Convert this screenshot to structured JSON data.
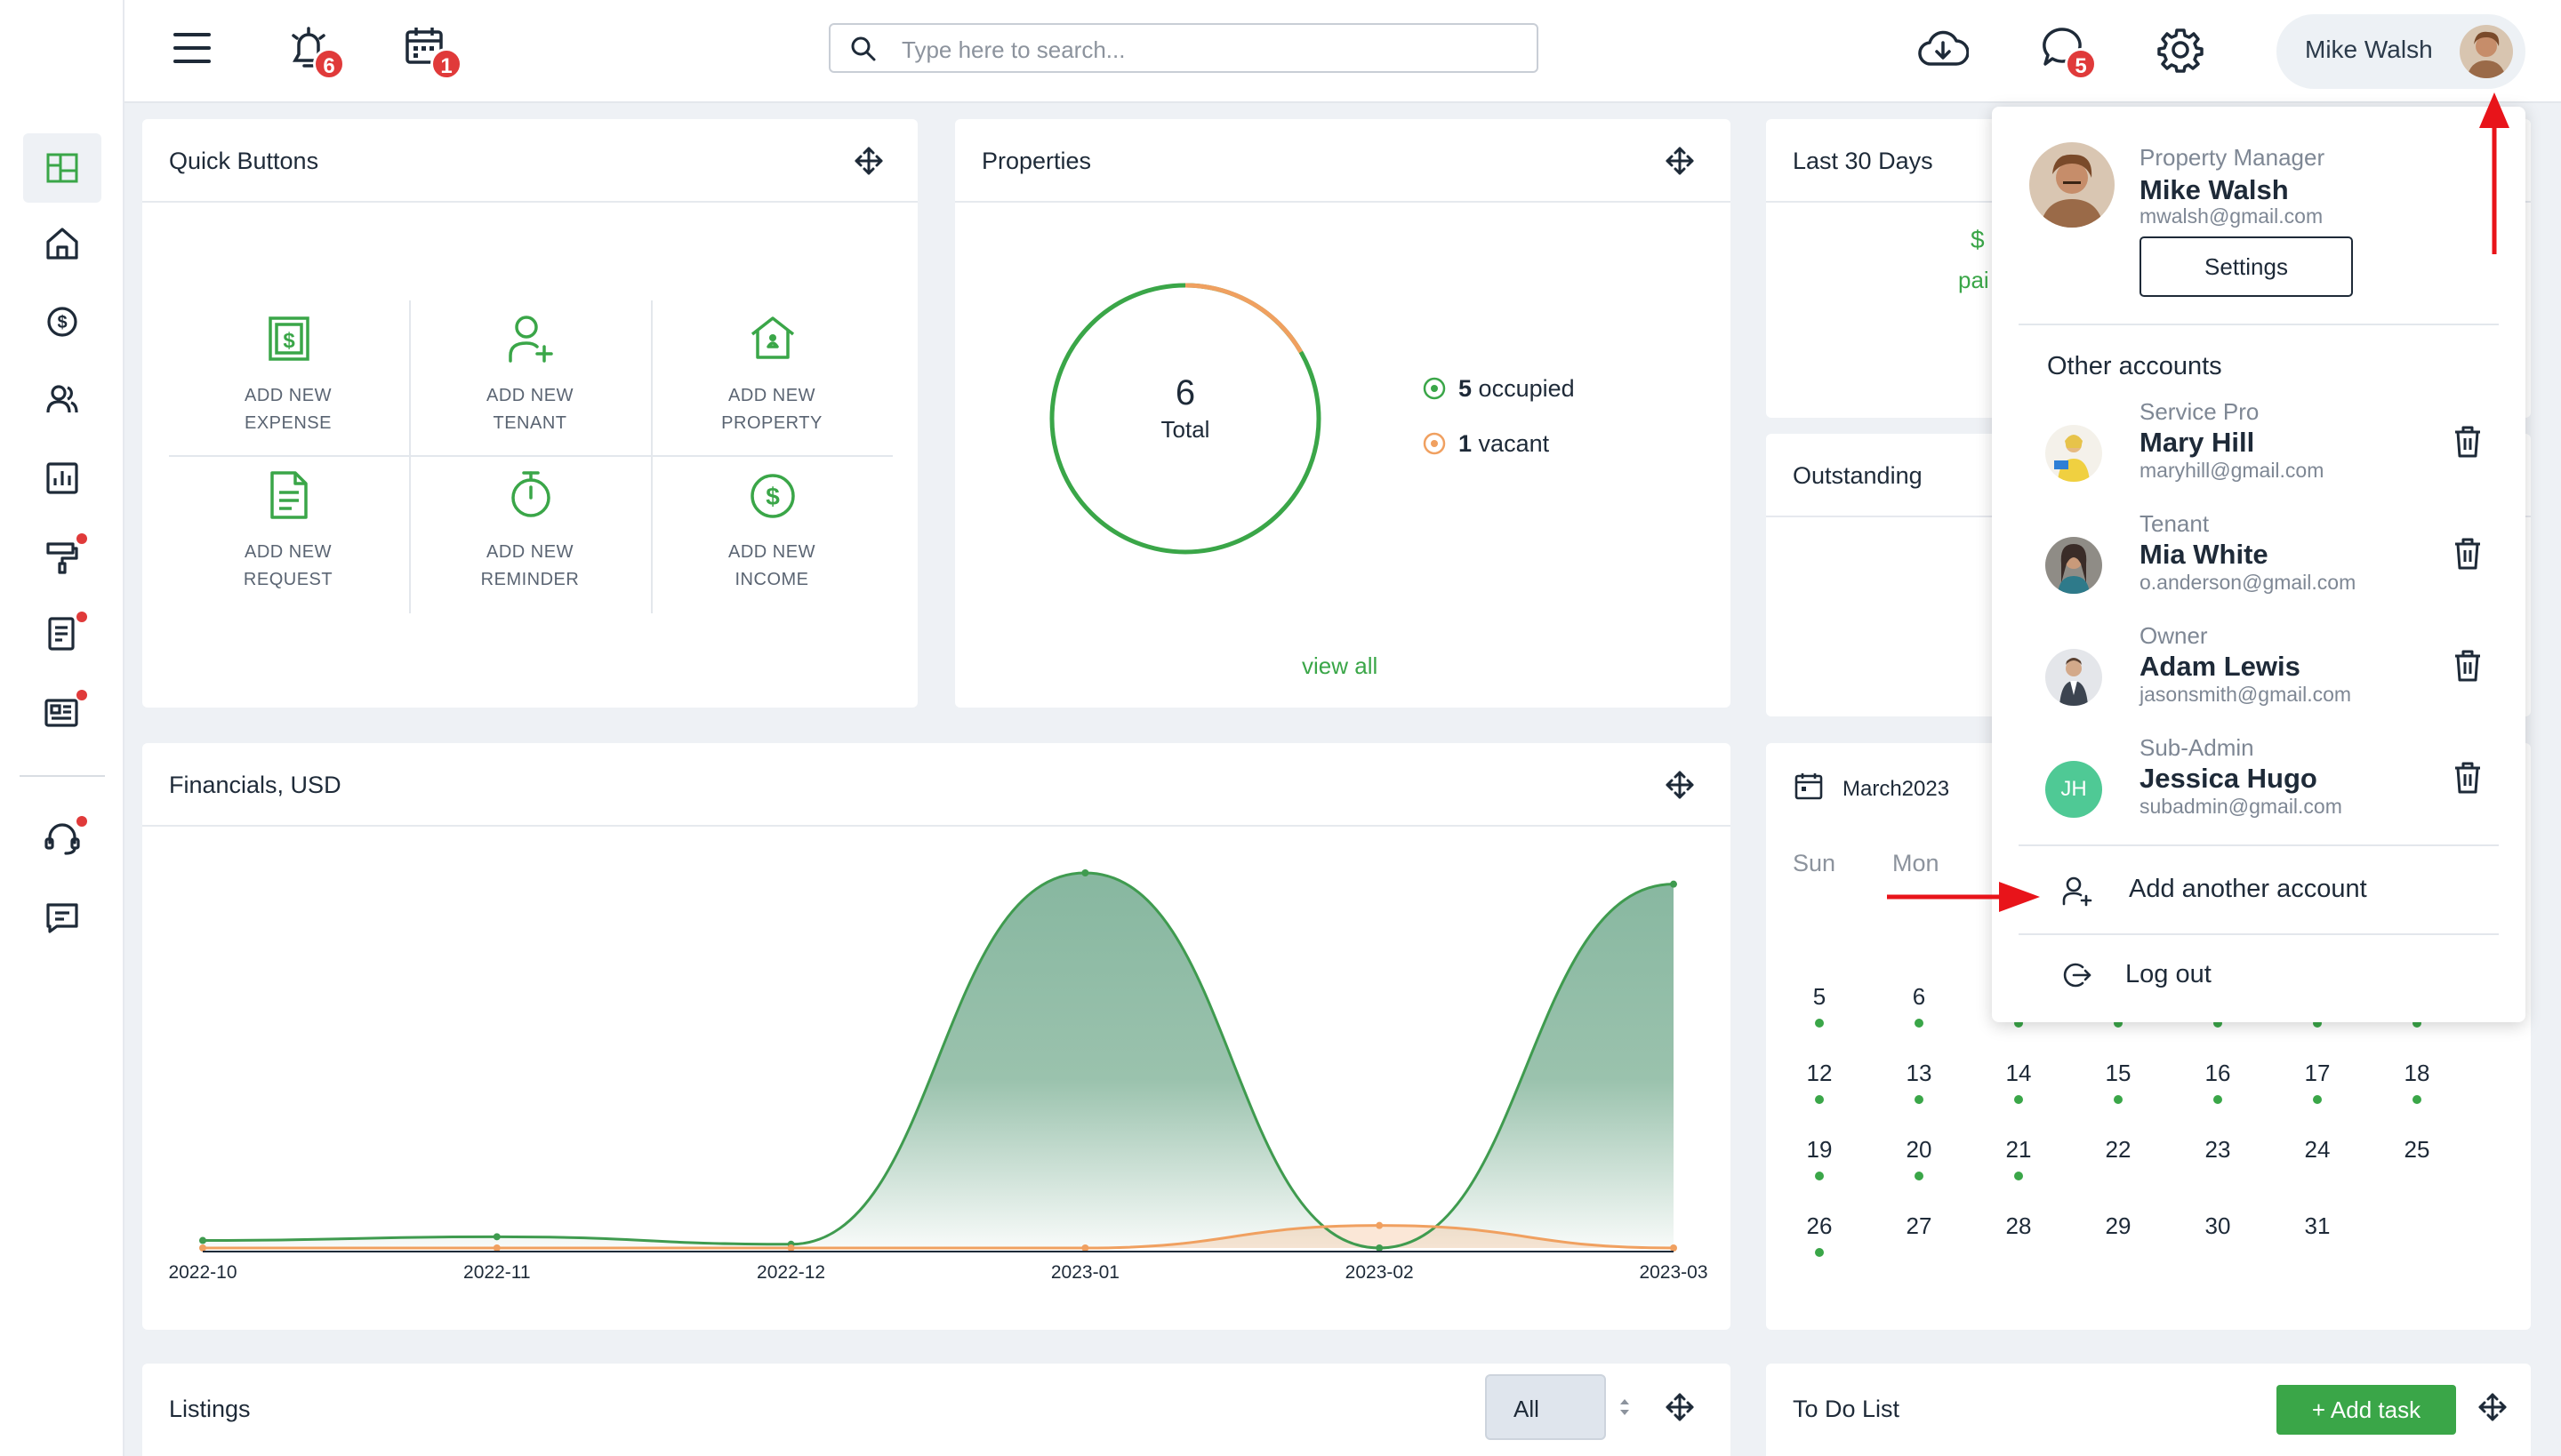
{
  "header": {
    "search_placeholder": "Type here to search...",
    "notifications_count": "6",
    "calendar_count": "1",
    "messages_count": "5",
    "user_name": "Mike Walsh"
  },
  "quick_buttons": {
    "title": "Quick Buttons",
    "items": [
      {
        "line1": "ADD NEW",
        "line2": "EXPENSE",
        "icon": "expense-icon"
      },
      {
        "line1": "ADD NEW",
        "line2": "TENANT",
        "icon": "add-user-icon"
      },
      {
        "line1": "ADD NEW",
        "line2": "PROPERTY",
        "icon": "house-icon"
      },
      {
        "line1": "ADD NEW",
        "line2": "REQUEST",
        "icon": "document-icon"
      },
      {
        "line1": "ADD NEW",
        "line2": "REMINDER",
        "icon": "stopwatch-icon"
      },
      {
        "line1": "ADD NEW",
        "line2": "INCOME",
        "icon": "dollar-circle-icon"
      }
    ]
  },
  "properties": {
    "title": "Properties",
    "total": "6",
    "total_label": "Total",
    "occupied_count": "5",
    "occupied_label": "occupied",
    "vacant_count": "1",
    "vacant_label": "vacant",
    "view_all": "view all"
  },
  "last30": {
    "title": "Last 30 Days",
    "amount_partial": "$",
    "paid_partial": "pai"
  },
  "outstanding": {
    "title": "Outstanding"
  },
  "financials": {
    "title": "Financials, USD"
  },
  "chart_data": {
    "type": "area",
    "title": "Financials, USD",
    "categories": [
      "2022-10",
      "2022-11",
      "2022-12",
      "2023-01",
      "2023-02",
      "2023-03"
    ],
    "series": [
      {
        "color": "#3f9b4f",
        "values": [
          2,
          3,
          1,
          100,
          0,
          97
        ]
      },
      {
        "color": "#f0a060",
        "values": [
          0,
          0,
          0,
          0,
          6,
          0
        ]
      }
    ],
    "ylim": [
      0,
      100
    ],
    "grid": false,
    "legend": "none"
  },
  "calendar": {
    "month": "March2023",
    "weekdays": [
      "Sun",
      "Mon"
    ],
    "weeks": [
      [
        {
          "d": "5",
          "dot": true
        },
        {
          "d": "6",
          "dot": true
        },
        {
          "d": "",
          "dot": true
        },
        {
          "d": "",
          "dot": true
        },
        {
          "d": "",
          "dot": true
        },
        {
          "d": "",
          "dot": true
        },
        {
          "d": "",
          "dot": true
        }
      ],
      [
        {
          "d": "12",
          "dot": true
        },
        {
          "d": "13",
          "dot": true
        },
        {
          "d": "14",
          "dot": true
        },
        {
          "d": "15",
          "dot": true
        },
        {
          "d": "16",
          "dot": true
        },
        {
          "d": "17",
          "dot": true
        },
        {
          "d": "18",
          "dot": true
        }
      ],
      [
        {
          "d": "19",
          "dot": true
        },
        {
          "d": "20",
          "dot": true
        },
        {
          "d": "21",
          "dot": true
        },
        {
          "d": "22",
          "dot": false
        },
        {
          "d": "23",
          "dot": false
        },
        {
          "d": "24",
          "dot": false
        },
        {
          "d": "25",
          "dot": false
        }
      ],
      [
        {
          "d": "26",
          "dot": true
        },
        {
          "d": "27",
          "dot": false
        },
        {
          "d": "28",
          "dot": false
        },
        {
          "d": "29",
          "dot": false
        },
        {
          "d": "30",
          "dot": false
        },
        {
          "d": "31",
          "dot": false
        },
        {
          "d": "",
          "dot": false
        }
      ]
    ]
  },
  "listings": {
    "title": "Listings",
    "filter_value": "All"
  },
  "todo": {
    "title": "To Do List",
    "add_task_label": "+ Add task"
  },
  "dropdown": {
    "current": {
      "role": "Property Manager",
      "name": "Mike Walsh",
      "email": "mwalsh@gmail.com",
      "settings_label": "Settings"
    },
    "other_title": "Other accounts",
    "accounts": [
      {
        "role": "Service Pro",
        "name": "Mary Hill",
        "email": "maryhill@gmail.com",
        "initials": ""
      },
      {
        "role": "Tenant",
        "name": "Mia White",
        "email": "o.anderson@gmail.com",
        "initials": ""
      },
      {
        "role": "Owner",
        "name": "Adam Lewis",
        "email": "jasonsmith@gmail.com",
        "initials": ""
      },
      {
        "role": "Sub-Admin",
        "name": "Jessica Hugo",
        "email": "subadmin@gmail.com",
        "initials": "JH"
      }
    ],
    "add_account": "Add another account",
    "logout": "Log out"
  },
  "colors": {
    "brand_green": "#3aa648",
    "accent_orange": "#f0a060",
    "badge_red": "#e03a3a",
    "annotation_red": "#e8141a"
  }
}
